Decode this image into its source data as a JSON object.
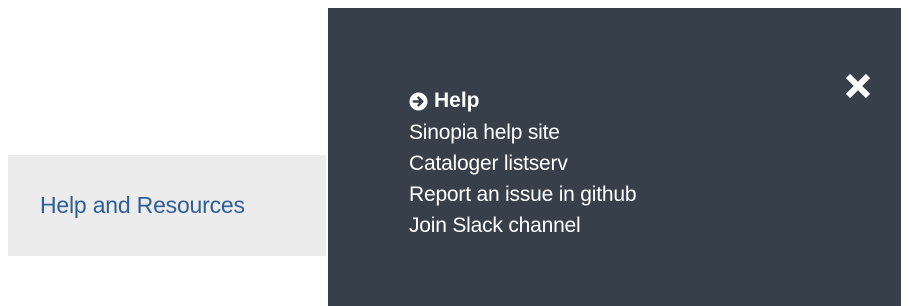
{
  "tab": {
    "label": "Help and Resources"
  },
  "panel": {
    "heading": "Help",
    "heading_icon": "circle-arrow-right-icon",
    "close_icon": "close-icon",
    "links": [
      {
        "label": "Sinopia help site"
      },
      {
        "label": "Cataloger listserv"
      },
      {
        "label": "Report an issue in github"
      },
      {
        "label": "Join Slack channel"
      }
    ]
  },
  "colors": {
    "panel_bg": "#363f4a",
    "tab_bg": "#ececec",
    "tab_text": "#2f5f9a",
    "panel_text": "#ffffff"
  }
}
